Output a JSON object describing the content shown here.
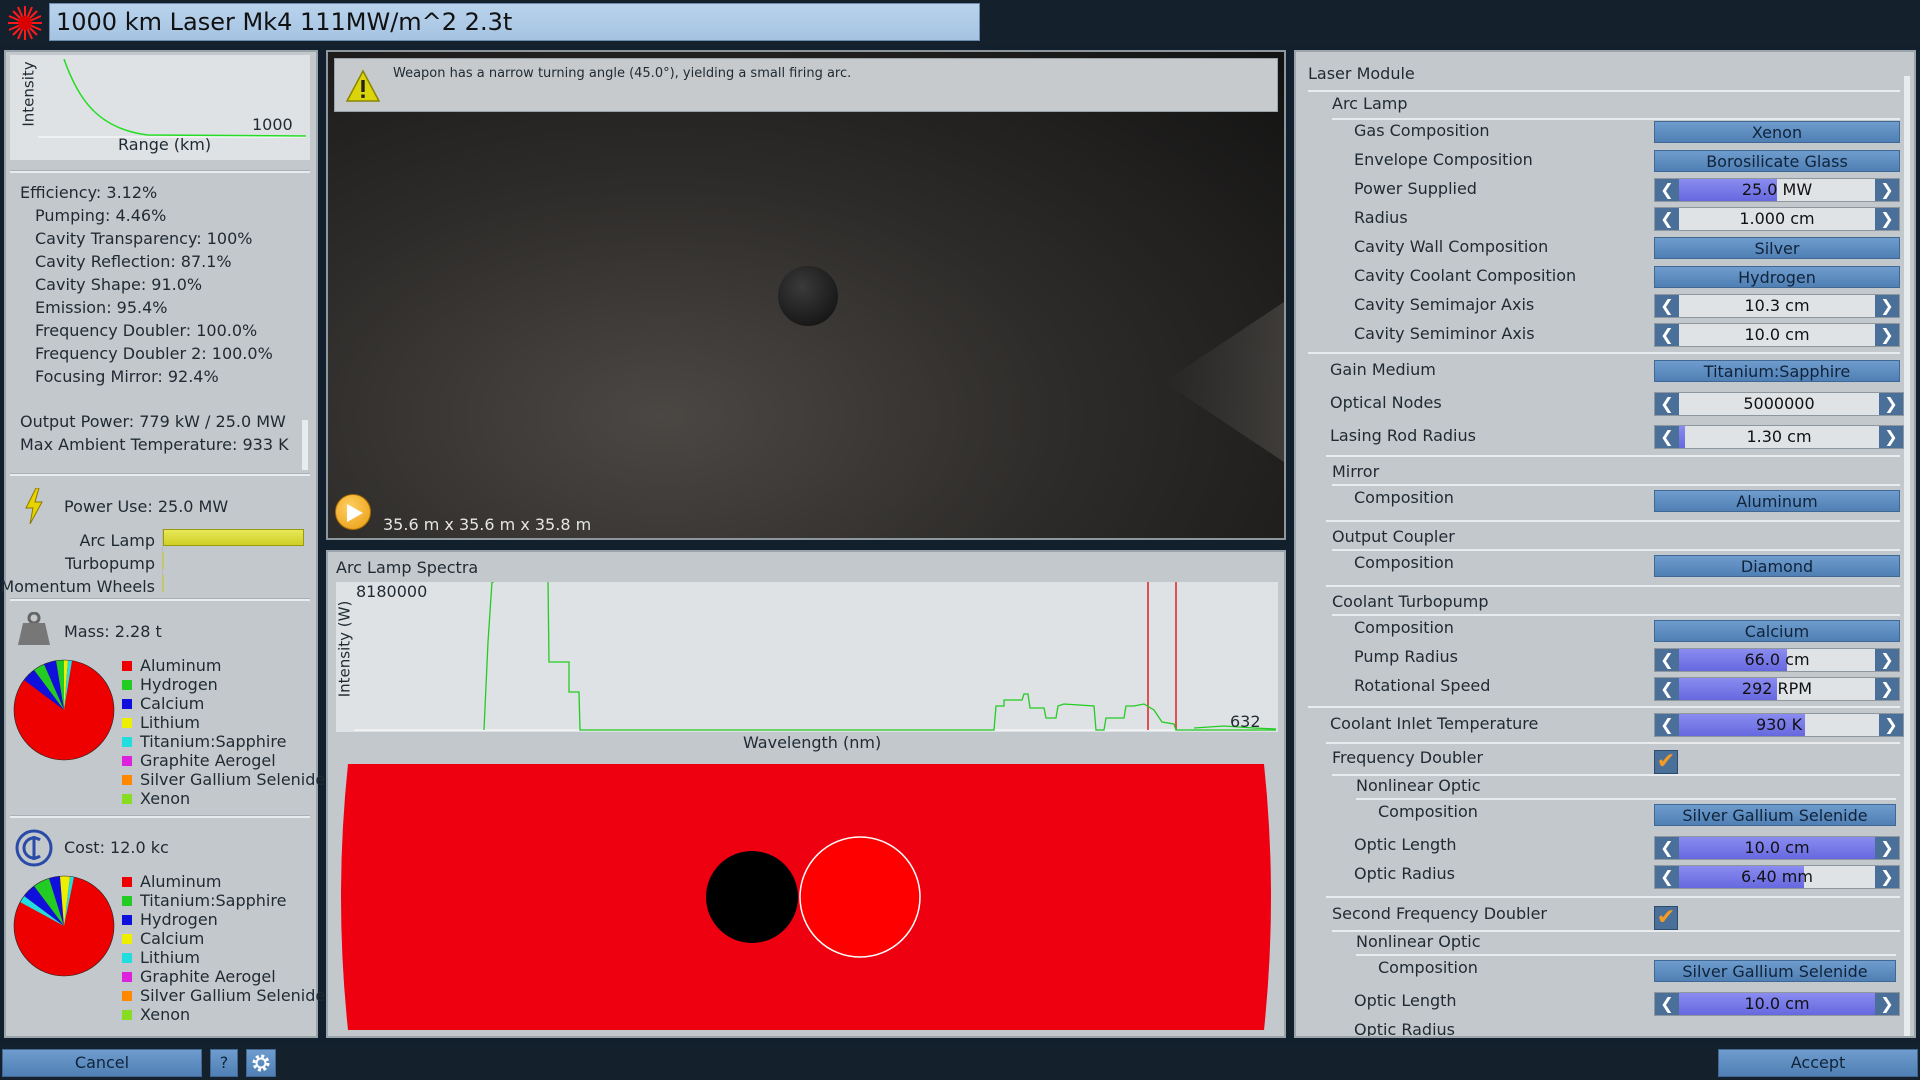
{
  "title": "1000 km Laser Mk4 111MW/m^2 2.3t",
  "left": {
    "range_chart": {
      "ylabel": "Intensity",
      "xlabel": "Range (km)",
      "max_label": "1000"
    },
    "stats": {
      "efficiency": "Efficiency: 3.12%",
      "pumping": "Pumping: 4.46%",
      "cavity_transparency": "Cavity Transparency: 100%",
      "cavity_reflection": "Cavity Reflection: 87.1%",
      "cavity_shape": "Cavity Shape: 91.0%",
      "emission": "Emission: 95.4%",
      "freq_doubler": "Frequency Doubler: 100.0%",
      "freq_doubler2": "Frequency Doubler 2: 100.0%",
      "focusing_mirror": "Focusing Mirror: 92.4%",
      "output_power": "Output Power: 779 kW / 25.0 MW",
      "max_temp": "Max Ambient Temperature: 933 K"
    },
    "power": {
      "label": "Power Use: 25.0 MW",
      "rows": [
        {
          "name": "Arc Lamp",
          "fraction": 1.0
        },
        {
          "name": "Turbopump",
          "fraction": 0.0
        },
        {
          "name": "Momentum Wheels",
          "fraction": 0.0
        }
      ]
    },
    "mass": {
      "label": "Mass: 2.28 t",
      "legend": [
        {
          "name": "Aluminum",
          "color": "#ee0000"
        },
        {
          "name": "Hydrogen",
          "color": "#22cc22"
        },
        {
          "name": "Calcium",
          "color": "#1010dd"
        },
        {
          "name": "Lithium",
          "color": "#eeee00"
        },
        {
          "name": "Titanium:Sapphire",
          "color": "#22dddd"
        },
        {
          "name": "Graphite Aerogel",
          "color": "#dd22dd"
        },
        {
          "name": "Silver Gallium Selenide",
          "color": "#ff8800"
        },
        {
          "name": "Xenon",
          "color": "#88dd22"
        }
      ]
    },
    "cost": {
      "label": "Cost: 12.0 kc",
      "legend": [
        {
          "name": "Aluminum",
          "color": "#ee0000"
        },
        {
          "name": "Titanium:Sapphire",
          "color": "#22cc22"
        },
        {
          "name": "Hydrogen",
          "color": "#1010dd"
        },
        {
          "name": "Calcium",
          "color": "#eeee00"
        },
        {
          "name": "Lithium",
          "color": "#22dddd"
        },
        {
          "name": "Graphite Aerogel",
          "color": "#dd22dd"
        },
        {
          "name": "Silver Gallium Selenide",
          "color": "#ff8800"
        },
        {
          "name": "Xenon",
          "color": "#88dd22"
        }
      ]
    }
  },
  "center": {
    "warning": "Weapon has a narrow turning angle (45.0°), yielding a small firing arc.",
    "dimensions": "35.6 m x 35.6 m x 35.8 m",
    "spectra": {
      "title": "Arc Lamp Spectra",
      "ylabel": "Intensity (W)",
      "xlabel": "Wavelength (nm)",
      "ymax_label": "8180000",
      "xmax_label": "632"
    }
  },
  "right": {
    "header": "Laser Module",
    "arc_lamp": {
      "title": "Arc Lamp",
      "gas_label": "Gas Composition",
      "gas": "Xenon",
      "envelope_label": "Envelope Composition",
      "envelope": "Borosilicate Glass",
      "power_label": "Power Supplied",
      "power": "25.0 MW",
      "power_frac": 0.5,
      "radius_label": "Radius",
      "radius": "1.000 cm",
      "radius_frac": 0,
      "wall_label": "Cavity Wall Composition",
      "wall": "Silver",
      "coolant_label": "Cavity Coolant Composition",
      "coolant": "Hydrogen",
      "semimajor_label": "Cavity Semimajor Axis",
      "semimajor": "10.3 cm",
      "semimajor_frac": 0,
      "semiminor_label": "Cavity Semiminor Axis",
      "semiminor": "10.0 cm",
      "semiminor_frac": 0
    },
    "gain_label": "Gain Medium",
    "gain": "Titanium:Sapphire",
    "nodes_label": "Optical Nodes",
    "nodes": "5000000",
    "nodes_frac": 0,
    "rod_label": "Lasing Rod Radius",
    "rod": "1.30 cm",
    "rod_frac": 0.03,
    "mirror": {
      "title": "Mirror",
      "comp_label": "Composition",
      "comp": "Aluminum"
    },
    "coupler": {
      "title": "Output Coupler",
      "comp_label": "Composition",
      "comp": "Diamond"
    },
    "turbopump": {
      "title": "Coolant Turbopump",
      "comp_label": "Composition",
      "comp": "Calcium",
      "pump_label": "Pump Radius",
      "pump": "66.0 cm",
      "pump_frac": 0.55,
      "speed_label": "Rotational Speed",
      "speed": "292 RPM",
      "speed_frac": 0.5
    },
    "inlet_label": "Coolant Inlet Temperature",
    "inlet": "930 K",
    "inlet_frac": 0.63,
    "fd1": {
      "title": "Frequency Doubler",
      "checked": "✔",
      "nlo_title": "Nonlinear Optic",
      "comp_label": "Composition",
      "comp": "Silver Gallium Selenide",
      "len_label": "Optic Length",
      "len": "10.0 cm",
      "len_frac": 1.0,
      "rad_label": "Optic Radius",
      "rad": "6.40 mm",
      "rad_frac": 0.64
    },
    "fd2": {
      "title": "Second Frequency Doubler",
      "checked": "✔",
      "nlo_title": "Nonlinear Optic",
      "comp_label": "Composition",
      "comp": "Silver Gallium Selenide",
      "len_label": "Optic Length",
      "len": "10.0 cm",
      "len_frac": 1.0,
      "rad_label": "Optic Radius"
    }
  },
  "footer": {
    "cancel": "Cancel",
    "help": "?",
    "accept": "Accept"
  }
}
